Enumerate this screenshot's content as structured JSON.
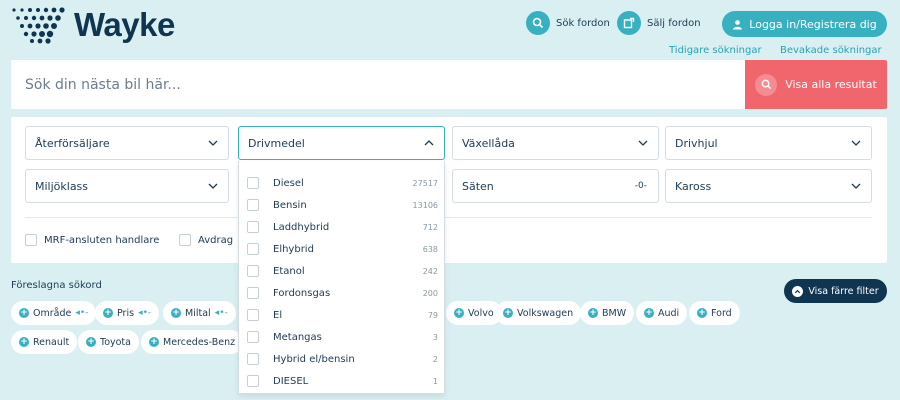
{
  "brand": {
    "name": "Wayke",
    "accent": "#37b0c0",
    "dark": "#0f3550",
    "coral": "#f0666c"
  },
  "header": {
    "search_cars": "Sök fordon",
    "sell_car": "Sälj fordon",
    "login": "Logga in/Registrera dig",
    "previous_searches": "Tidigare sökningar",
    "saved_searches": "Bevakade sökningar"
  },
  "search": {
    "placeholder": "Sök din nästa bil här...",
    "show_all": "Visa alla resultat"
  },
  "filters": {
    "dealer": "Återförsäljare",
    "fuel": "Drivmedel",
    "gearbox": "Växellåda",
    "drive": "Drivhjul",
    "env_class": "Miljöklass",
    "seats": "Säten",
    "seats_suffix": "-0-",
    "body": "Kaross",
    "mrf_dealer": "MRF-ansluten handlare",
    "deductible": "Avdrag"
  },
  "fuel_options": [
    {
      "label": "Diesel",
      "count": "27517"
    },
    {
      "label": "Bensin",
      "count": "13106"
    },
    {
      "label": "Laddhybrid",
      "count": "712"
    },
    {
      "label": "Elhybrid",
      "count": "638"
    },
    {
      "label": "Etanol",
      "count": "242"
    },
    {
      "label": "Fordonsgas",
      "count": "200"
    },
    {
      "label": "El",
      "count": "79"
    },
    {
      "label": "Metangas",
      "count": "3"
    },
    {
      "label": "Hybrid el/bensin",
      "count": "2"
    },
    {
      "label": "DIESEL",
      "count": "1"
    }
  ],
  "suggested": {
    "title": "Föreslagna sökord",
    "fewer_filters": "Visa färre filter",
    "chips": [
      "Område",
      "Pris",
      "Miltal",
      "Volvo",
      "Volkswagen",
      "BMW",
      "Audi",
      "Ford",
      "Renault",
      "Toyota",
      "Mercedes-Benz"
    ],
    "range_arrow": "◂•-"
  }
}
